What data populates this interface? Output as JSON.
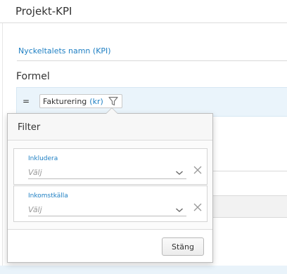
{
  "header": {
    "title": "Projekt-KPI"
  },
  "kpi": {
    "name_label": "Nyckeltalets namn (KPI)"
  },
  "formula": {
    "label": "Formel",
    "operator": "=",
    "chip_name": "Fakturering",
    "chip_unit": "(kr)"
  },
  "filter_popover": {
    "title": "Filter",
    "filters": [
      {
        "label": "Inkludera",
        "placeholder": "Välj"
      },
      {
        "label": "Inkomstkälla",
        "placeholder": "Välj"
      }
    ],
    "close_label": "Stäng"
  },
  "colors": {
    "accent": "#1e7fc3",
    "formula_bg": "#eaf4fb"
  }
}
